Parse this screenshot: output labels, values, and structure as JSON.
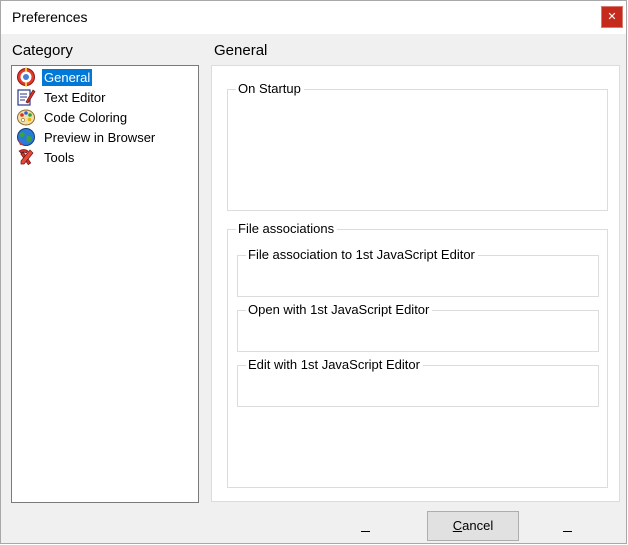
{
  "window": {
    "title": "Preferences",
    "close_label": "✕"
  },
  "sidebar": {
    "label": "Category",
    "items": [
      {
        "label": "General",
        "icon": "general-settings-icon",
        "selected": true
      },
      {
        "label": "Text Editor",
        "icon": "text-editor-icon"
      },
      {
        "label": "Code Coloring",
        "icon": "palette-icon"
      },
      {
        "label": "Preview in Browser",
        "icon": "globe-icon"
      },
      {
        "label": "Tools",
        "icon": "tools-icon"
      }
    ]
  },
  "main": {
    "header": "General",
    "on_startup": {
      "legend": "On Startup"
    },
    "file_associations": {
      "legend": "File associations",
      "groups": [
        {
          "legend": "File association to 1st JavaScript Editor"
        },
        {
          "legend": "Open with 1st JavaScript Editor"
        },
        {
          "legend": "Edit with 1st JavaScript Editor"
        }
      ]
    }
  },
  "footer": {
    "cancel_first": "C",
    "cancel_rest": "ancel"
  },
  "colors": {
    "selection": "#0078d7",
    "close_button": "#c42b1c"
  }
}
